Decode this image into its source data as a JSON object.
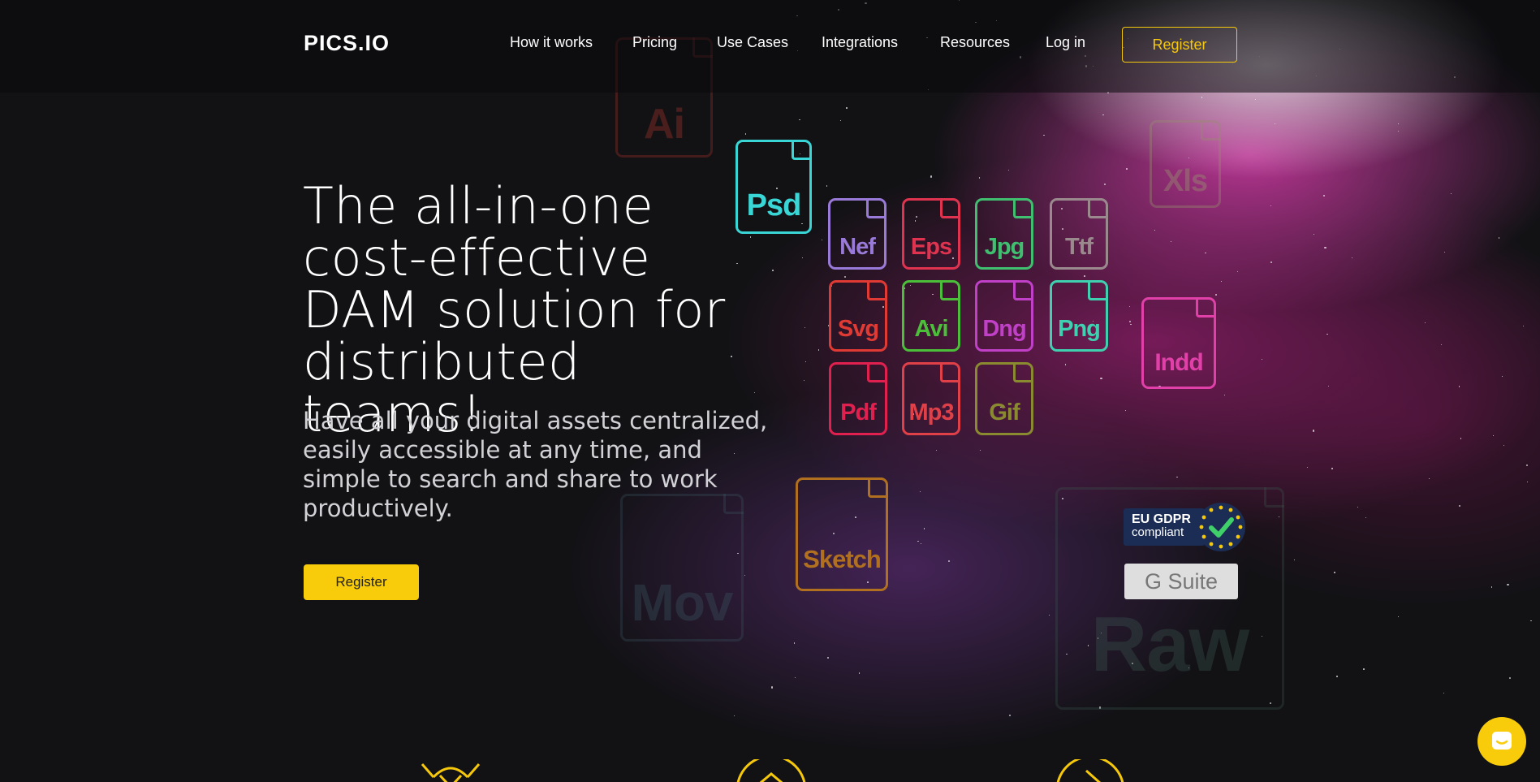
{
  "header": {
    "logo": "PICS.IO",
    "nav": [
      "How it works",
      "Pricing",
      "Use Cases",
      "Integrations",
      "Resources",
      "Log in"
    ],
    "register": "Register"
  },
  "hero": {
    "title": "The all-in-one cost-effective DAM solution for distributed teams!",
    "subtitle": "Have all your digital assets centralized, easily accessible at any time, and simple to search and share to work productively.",
    "register": "Register"
  },
  "file_types": {
    "bright": [
      "Psd",
      "Nef",
      "Eps",
      "Jpg",
      "Ttf",
      "Svg",
      "Avi",
      "Dng",
      "Png",
      "Indd",
      "Pdf",
      "Mp3",
      "Gif",
      "Sketch"
    ],
    "faded": [
      "Ai",
      "Xls",
      "Mov",
      "Raw"
    ]
  },
  "badges": {
    "gdpr_line1": "EU GDPR",
    "gdpr_line2": "compliant",
    "gsuite": "G Suite"
  },
  "colors": {
    "accent": "#f9cc0b",
    "psd": "#3ad6d6",
    "nef": "#9a7ad8",
    "eps": "#e0334f",
    "jpg": "#3fbf6f",
    "ttf": "#9a8a8e",
    "svg": "#e03a34",
    "avi": "#4cbf3a",
    "dng": "#c040c8",
    "png": "#3fd0b0",
    "indd": "#e040a8",
    "pdf": "#e0204e",
    "mp3": "#e04048",
    "gif": "#8a8a30",
    "sketch": "#b07020"
  }
}
